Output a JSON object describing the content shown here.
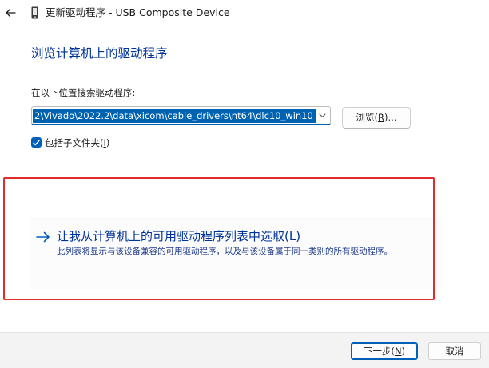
{
  "window": {
    "title": "更新驱动程序 - USB Composite Device",
    "back_icon": "arrow-left-icon",
    "device_icon": "usb-device-icon"
  },
  "heading": "浏览计算机上的驱动程序",
  "search": {
    "label": "在以下位置搜索驱动程序:",
    "path_value": "2\\Vivado\\2022.2\\data\\xicom\\cable_drivers\\nt64\\dlc10_win10",
    "dropdown_icon": "chevron-down-icon",
    "browse_label": "浏览(",
    "browse_key": "R",
    "browse_suffix": ")...",
    "include_subfolders_label": "包括子文件夹(",
    "include_subfolders_key": "I",
    "include_subfolders_suffix": ")",
    "include_subfolders_checked": true
  },
  "pick_option": {
    "title": "让我从计算机上的可用驱动程序列表中选取(L)",
    "description": "此列表将显示与该设备兼容的可用驱动程序，以及与该设备属于同一类别的所有驱动程序。",
    "arrow_icon": "arrow-right-icon"
  },
  "footer": {
    "next_label": "下一步(",
    "next_key": "N",
    "next_suffix": ")",
    "cancel_label": "取消"
  },
  "colors": {
    "accent": "#005fb8",
    "link": "#003399",
    "highlight_frame": "#e22b2b",
    "selection": "#0063b1"
  }
}
